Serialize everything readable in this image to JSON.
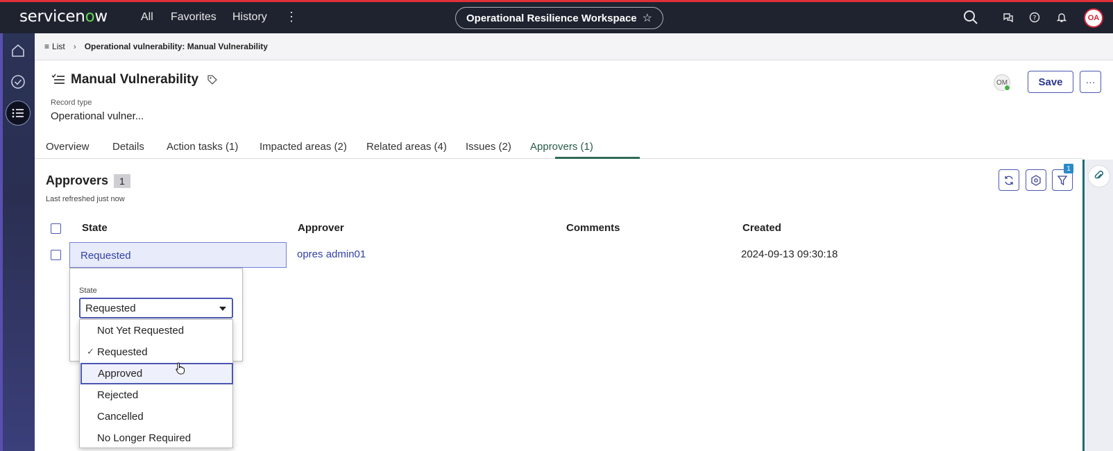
{
  "topnav": {
    "logo_prefix": "servicen",
    "logo_o": "o",
    "logo_suffix": "w",
    "links": [
      "All",
      "Favorites",
      "History"
    ],
    "workspace": "Operational Resilience Workspace",
    "avatar": "OA"
  },
  "breadcrumb": {
    "list": "List",
    "current": "Operational vulnerability: Manual Vulnerability"
  },
  "record": {
    "title": "Manual Vulnerability",
    "type_label": "Record type",
    "type_value": "Operational vulner...",
    "presence": "OM",
    "save_label": "Save",
    "more_label": "···"
  },
  "tabs": [
    {
      "label": "Overview"
    },
    {
      "label": "Details"
    },
    {
      "label": "Action tasks (1)"
    },
    {
      "label": "Impacted areas (2)"
    },
    {
      "label": "Related areas (4)"
    },
    {
      "label": "Issues (2)"
    },
    {
      "label": "Approvers (1)",
      "active": true
    }
  ],
  "approvers": {
    "heading": "Approvers",
    "count": "1",
    "refreshed": "Last refreshed just now",
    "filter_badge": "1",
    "columns": [
      "State",
      "Approver",
      "Comments",
      "Created"
    ],
    "rows": [
      {
        "state": "Requested",
        "approver": "opres admin01",
        "comments": "",
        "created": "2024-09-13 09:30:18"
      }
    ]
  },
  "popover": {
    "label": "State",
    "selected": "Requested",
    "options": [
      "Not Yet Requested",
      "Requested",
      "Approved",
      "Rejected",
      "Cancelled",
      "No Longer Required"
    ],
    "checked": "Requested",
    "hovered": "Approved"
  },
  "colors": {
    "topbar": "#1f2330",
    "accent": "#4c57b0",
    "link": "#3341a8",
    "tab_active": "#2d6a57"
  }
}
